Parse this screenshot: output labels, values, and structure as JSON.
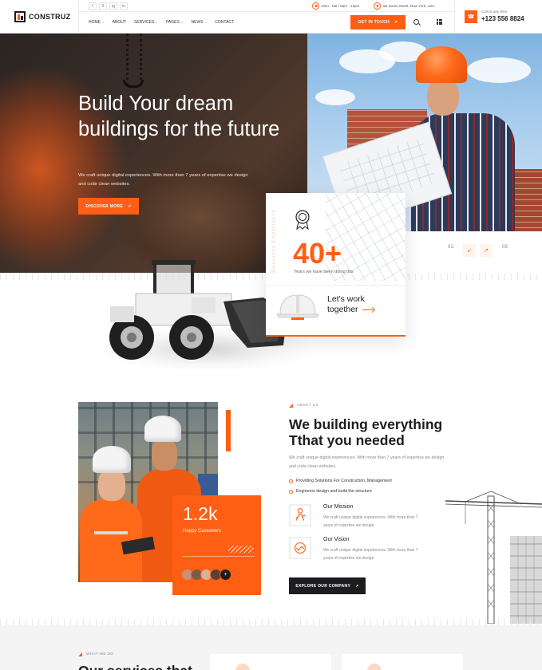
{
  "brand": {
    "name": "CONSTRUZ",
    "accent": "#ff5e14",
    "dark": "#1d1d1f"
  },
  "topbar": {
    "social": [
      "f",
      "X",
      "ig",
      "in"
    ],
    "hours": "Mon - Sat / 8am - 12pm",
    "address": "96 Jones Street, New York, USA"
  },
  "nav": {
    "items": [
      {
        "label": "HOME",
        "dropdown": true
      },
      {
        "label": "ABOUT",
        "dropdown": false
      },
      {
        "label": "SERVICES",
        "dropdown": true
      },
      {
        "label": "PAGES",
        "dropdown": true
      },
      {
        "label": "NEWS",
        "dropdown": true
      },
      {
        "label": "CONTACT",
        "dropdown": false
      }
    ],
    "cta": "GET IN TOUCH"
  },
  "call": {
    "label": "Call us any time",
    "number": "+123 556 8824"
  },
  "hero": {
    "title": "Build Your dream buildings for the future",
    "description": "We craft unique digital experiences. With more than 7 years of expertise we design and code clean websites.",
    "button": "DISCOVER MORE",
    "slide_current": "01:",
    "slide_total": "03"
  },
  "experience": {
    "side_text": "Business Experience",
    "number": "40+",
    "label": "Years we have been doing this",
    "cta_line1": "Let's work",
    "cta_line2": "together"
  },
  "about": {
    "tag": "ABOUT US",
    "title": "We building everything Tthat you needed",
    "description": "We craft unique digital experiences. With more than 7 years of expertise we design and code clean websites.",
    "checklist": [
      "Providing Solutions For Construction, Management",
      "Engineers design and build the structure"
    ],
    "features": [
      {
        "title": "Our Mission",
        "description": "We craft unique digital experiences. With more than 7 years of expertise we design"
      },
      {
        "title": "Our Vision",
        "description": "We craft unique digital experiences. With more than 7 years of expertise we design"
      }
    ],
    "button": "EXPLORE OUR COMPANY",
    "stat_number": "1.2k",
    "stat_label": "Happy Customers"
  },
  "services": {
    "tag": "WHAT WE DO",
    "title": "Our services that"
  }
}
